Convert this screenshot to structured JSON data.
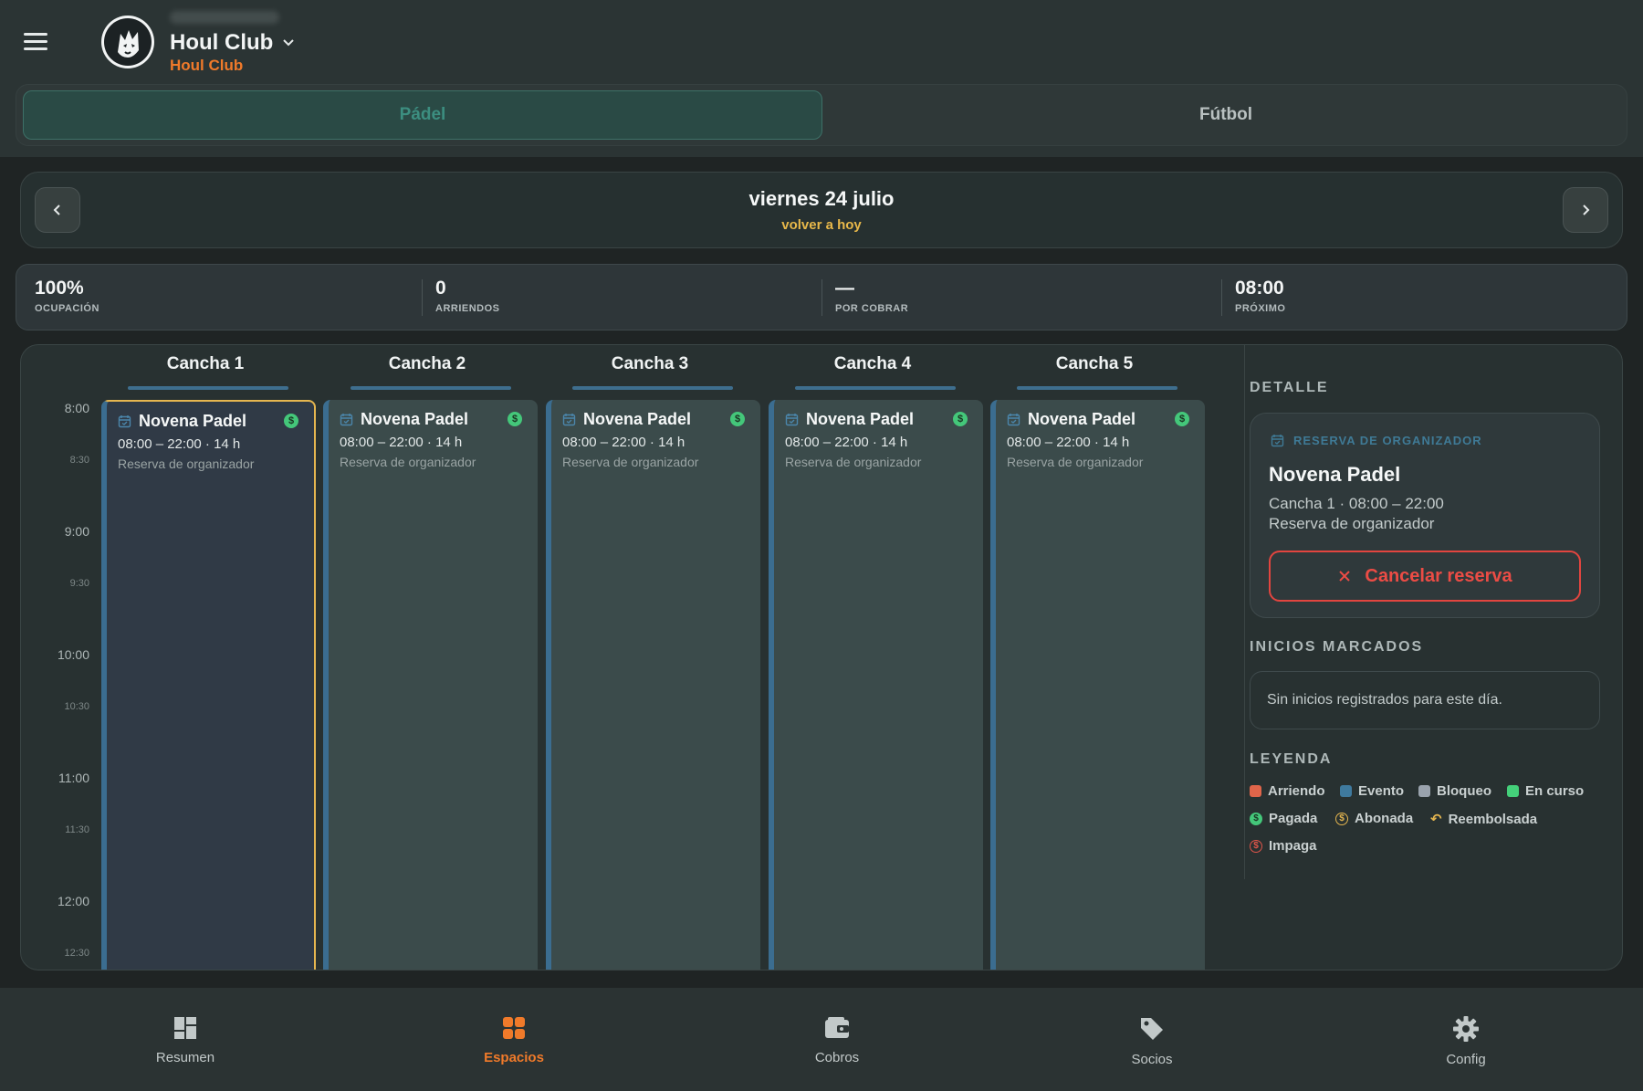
{
  "header": {
    "club_name": "Houl Club",
    "club_subtitle": "Houl Club"
  },
  "sport_tabs": [
    {
      "label": "Pádel",
      "active": true
    },
    {
      "label": "Fútbol",
      "active": false
    }
  ],
  "date_nav": {
    "title": "viernes 24 julio",
    "today_link": "volver a hoy"
  },
  "stats": [
    {
      "value": "100%",
      "label": "OCUPACIÓN"
    },
    {
      "value": "0",
      "label": "ARRIENDOS"
    },
    {
      "value": "—",
      "label": "POR COBRAR"
    },
    {
      "value": "08:00",
      "label": "PRÓXIMO"
    }
  ],
  "courts": [
    "Cancha 1",
    "Cancha 2",
    "Cancha 3",
    "Cancha 4",
    "Cancha 5"
  ],
  "time_labels": {
    "hours": [
      "8:00",
      "9:00",
      "10:00",
      "11:00",
      "12:00"
    ],
    "halves": [
      "8:30",
      "9:30",
      "10:30",
      "11:30",
      "12:30"
    ]
  },
  "bookings": [
    {
      "name": "Novena Padel",
      "time": "08:00 – 22:00 · 14 h",
      "desc": "Reserva de organizador",
      "paid_symbol": "$"
    },
    {
      "name": "Novena Padel",
      "time": "08:00 – 22:00 · 14 h",
      "desc": "Reserva de organizador",
      "paid_symbol": "$"
    },
    {
      "name": "Novena Padel",
      "time": "08:00 – 22:00 · 14 h",
      "desc": "Reserva de organizador",
      "paid_symbol": "$"
    },
    {
      "name": "Novena Padel",
      "time": "08:00 – 22:00 · 14 h",
      "desc": "Reserva de organizador",
      "paid_symbol": "$"
    },
    {
      "name": "Novena Padel",
      "time": "08:00 – 22:00 · 14 h",
      "desc": "Reserva de organizador",
      "paid_symbol": "$"
    }
  ],
  "side": {
    "detail_title": "DETALLE",
    "detail": {
      "kind": "RESERVA DE ORGANIZADOR",
      "name": "Novena Padel",
      "line1": "Cancha 1 · 08:00 – 22:00",
      "line2": "Reserva de organizador",
      "cancel_label": "Cancelar reserva"
    },
    "inicios_title": "INICIOS MARCADOS",
    "inicios_empty": "Sin inicios registrados para este día.",
    "legend_title": "LEYENDA",
    "legend": [
      {
        "label": "Arriendo",
        "color": "#e0654a"
      },
      {
        "label": "Evento",
        "color": "#3f7a9e"
      },
      {
        "label": "Bloqueo",
        "color": "#9aa3ad"
      },
      {
        "label": "En curso",
        "color": "#44d07a"
      },
      {
        "label": "Pagada",
        "color": "#44c77a",
        "symbol": "$"
      },
      {
        "label": "Abonada",
        "color": "#e5b64f",
        "symbol": "$"
      },
      {
        "label": "Reembolsada",
        "color": "#e5b64f",
        "symbol": "↶"
      },
      {
        "label": "Impaga",
        "color": "#e0554a",
        "symbol": "$"
      }
    ]
  },
  "bottom_nav": [
    {
      "label": "Resumen",
      "icon": "dashboard-icon"
    },
    {
      "label": "Espacios",
      "icon": "grid-icon",
      "active": true
    },
    {
      "label": "Cobros",
      "icon": "wallet-icon"
    },
    {
      "label": "Socios",
      "icon": "tag-icon"
    },
    {
      "label": "Config",
      "icon": "gear-icon"
    }
  ],
  "colors": {
    "accent": "#f07a2a",
    "today_link": "#e8b84a",
    "selected_border": "#e5b64f",
    "event_blue": "#3b6d90",
    "cancel_red": "#e2453f"
  }
}
